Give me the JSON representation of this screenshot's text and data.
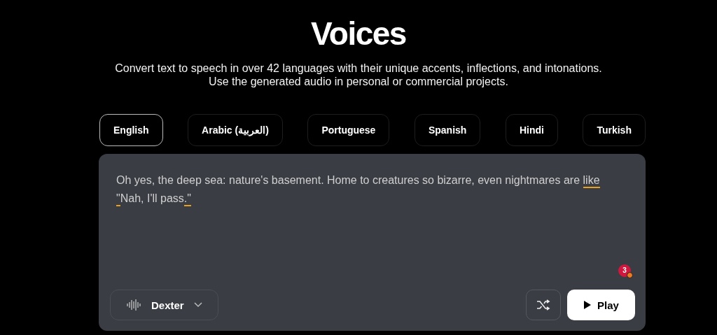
{
  "title": "Voices",
  "subtitle": [
    "Convert text to speech in over 42 languages with their unique accents, inflections, and intonations.",
    "Use the generated audio in personal or commercial projects."
  ],
  "tabs": [
    {
      "label": "English",
      "selected": true
    },
    {
      "label": "Arabic (العربية)",
      "selected": false
    },
    {
      "label": "Portuguese",
      "selected": false
    },
    {
      "label": "Spanish",
      "selected": false
    },
    {
      "label": "Hindi",
      "selected": false
    },
    {
      "label": "Turkish",
      "selected": false
    }
  ],
  "editor": {
    "segments": [
      {
        "text": "Oh yes, the deep sea: nature's basement. Home to creatures so bizarre, even nightmares are ",
        "flagged": false
      },
      {
        "text": "like ",
        "flagged": true
      },
      {
        "text": "\"",
        "flagged": true
      },
      {
        "text": "Nah, I'll pass",
        "flagged": false
      },
      {
        "text": ".\"",
        "flagged": true
      }
    ],
    "issue_count": "3",
    "voice": "Dexter",
    "play_label": "Play"
  }
}
